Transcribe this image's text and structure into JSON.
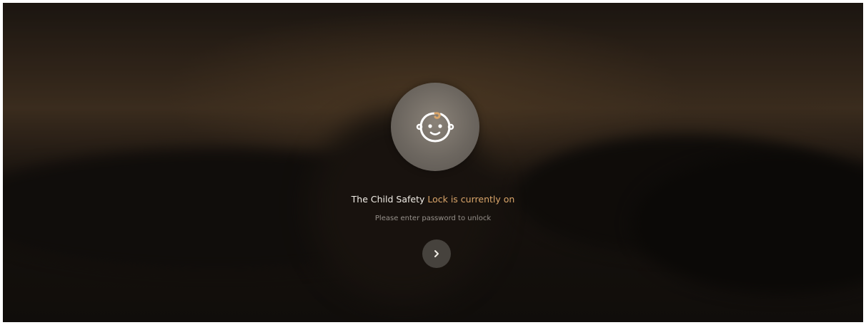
{
  "screen": {
    "title": "",
    "lock_icon": "baby-face-icon",
    "status": {
      "prefix": "The Child Safety ",
      "highlight": "Lock is currently on"
    },
    "subtitle": "Please enter password to unlock",
    "unlock_button": {
      "icon": "chevron-right-icon",
      "label": ""
    }
  },
  "colors": {
    "accent": "#d9a56a",
    "text": "#f1ede6",
    "background": "#1b1612"
  }
}
